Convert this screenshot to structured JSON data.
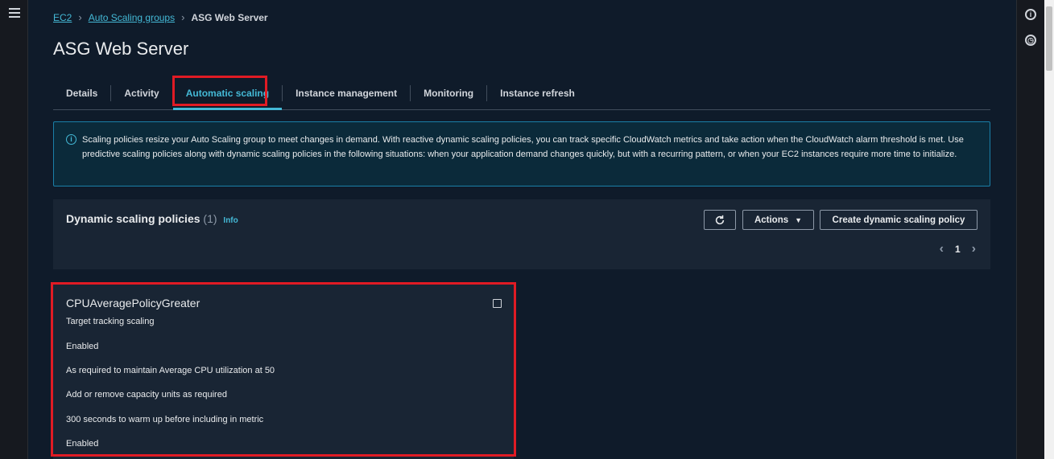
{
  "breadcrumb": {
    "ec2": "EC2",
    "asg": "Auto Scaling groups",
    "current": "ASG Web Server"
  },
  "page": {
    "title": "ASG Web Server"
  },
  "tabs": [
    {
      "label": "Details"
    },
    {
      "label": "Activity"
    },
    {
      "label": "Automatic scaling"
    },
    {
      "label": "Instance management"
    },
    {
      "label": "Monitoring"
    },
    {
      "label": "Instance refresh"
    }
  ],
  "info_alert": {
    "icon": "info-icon",
    "text": "Scaling policies resize your Auto Scaling group to meet changes in demand. With reactive dynamic scaling policies, you can track specific CloudWatch metrics and take action when the CloudWatch alarm threshold is met. Use predictive scaling policies along with dynamic scaling policies in the following situations: when your application demand changes quickly, but with a recurring pattern, or when your EC2 instances require more time to initialize."
  },
  "policies_panel": {
    "title": "Dynamic scaling policies",
    "count": "(1)",
    "info_link": "Info",
    "actions_label": "Actions",
    "create_label": "Create dynamic scaling policy",
    "page_number": "1"
  },
  "policy_card": {
    "name": "CPUAveragePolicyGreater",
    "rows": [
      "Target tracking scaling",
      "Enabled",
      "As required to maintain Average CPU utilization at 50",
      "Add or remove capacity units as required",
      "300 seconds to warm up before including in metric",
      "Enabled"
    ]
  },
  "colors": {
    "accent": "#44b9d6",
    "highlight": "#e01b24",
    "background": "#0f1b2a"
  }
}
